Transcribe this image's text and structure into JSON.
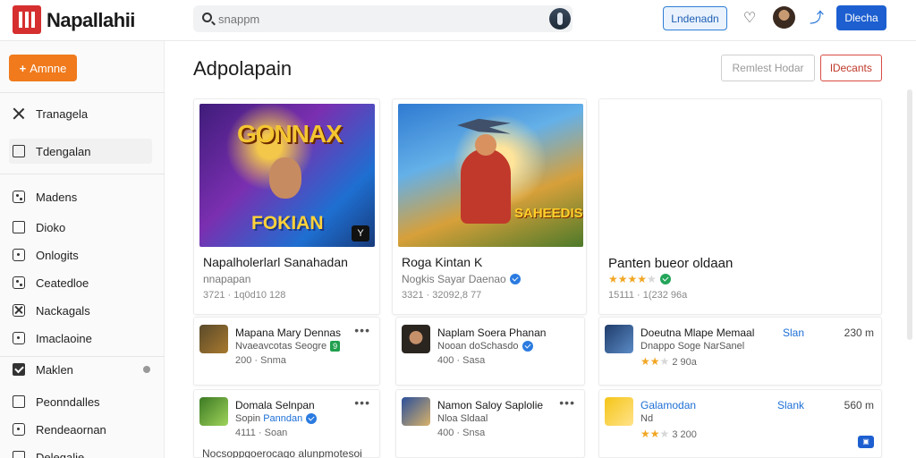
{
  "header": {
    "brand": "Napallahii",
    "search_placeholder": "snappm",
    "outline_button": "Lndenadn",
    "solid_button": "Dlecha"
  },
  "sidebar": {
    "cta_label": "Amnne",
    "top_items": [
      {
        "label": "Tranagela",
        "icon": "close-icon"
      },
      {
        "label": "Tdengalan",
        "icon": "square-icon"
      }
    ],
    "items": [
      {
        "label": "Madens",
        "icon": "dice-icon"
      },
      {
        "label": "Dioko",
        "icon": "square-icon"
      },
      {
        "label": "Onlogits",
        "icon": "dot-square-icon"
      },
      {
        "label": "Ceatedloe",
        "icon": "grid-icon"
      },
      {
        "label": "Nackagals",
        "icon": "cross-square-icon"
      },
      {
        "label": "Imaclaoine",
        "icon": "dot-square-icon"
      },
      {
        "label": "Maklen",
        "icon": "checked-box-icon"
      },
      {
        "label": "Peonndalles",
        "icon": "square-icon"
      },
      {
        "label": "Rendeaornan",
        "icon": "dot-square-icon"
      },
      {
        "label": "Delegalie",
        "icon": "square-icon"
      }
    ]
  },
  "main": {
    "title": "Adpolapain",
    "btn_grey": "Remlest Hodar",
    "btn_red": "lDecants",
    "featured": [
      {
        "title": "Napalholerlarl Sanahadan",
        "sub": "nnapapan",
        "meta": "3721 · 1q0d10 128",
        "art_title": "GONNAX",
        "art_sub": "FOKIAN"
      },
      {
        "title": "Roga Kintan K",
        "sub": "Nogkis Sayar Daenao",
        "meta": "3321 · 32092,8 77",
        "art_title": "SAHEEDIS"
      },
      {
        "title": "Panten bueor oldaan",
        "sub": "15111 · 1(232 96a",
        "rating": 4
      }
    ],
    "rows": [
      {
        "title": "Mapana Mary Dennas",
        "sub": "Nvaeavcotas Seogre",
        "tag": "9",
        "meta": "200 · Snma"
      },
      {
        "title": "Naplam Soera Phanan",
        "sub": "Nooan doSchasdo",
        "meta": "400 · Sasa"
      },
      {
        "title": "Doeutna Mlape Memaal",
        "link": "Slan",
        "size": "230 m",
        "sub": "Dnappo Soge NarSanel",
        "meta": "2 90a",
        "rating": 2
      },
      {
        "title": "Domala Selnpan",
        "sub_prefix": "Sopin",
        "sub_blue": "Panndan",
        "meta": "4111 · Soan"
      },
      {
        "title": "Namon Saloy Saplolie",
        "sub": "Nloa Sldaal",
        "meta": "400 · Snsa"
      },
      {
        "title": "Galamodan",
        "link": "Slank",
        "size": "560 m",
        "sub": "Nd",
        "meta": "3 200",
        "rating": 2
      }
    ],
    "bottom_text": "Nocsoppgoerocago alunpmotesoi"
  }
}
